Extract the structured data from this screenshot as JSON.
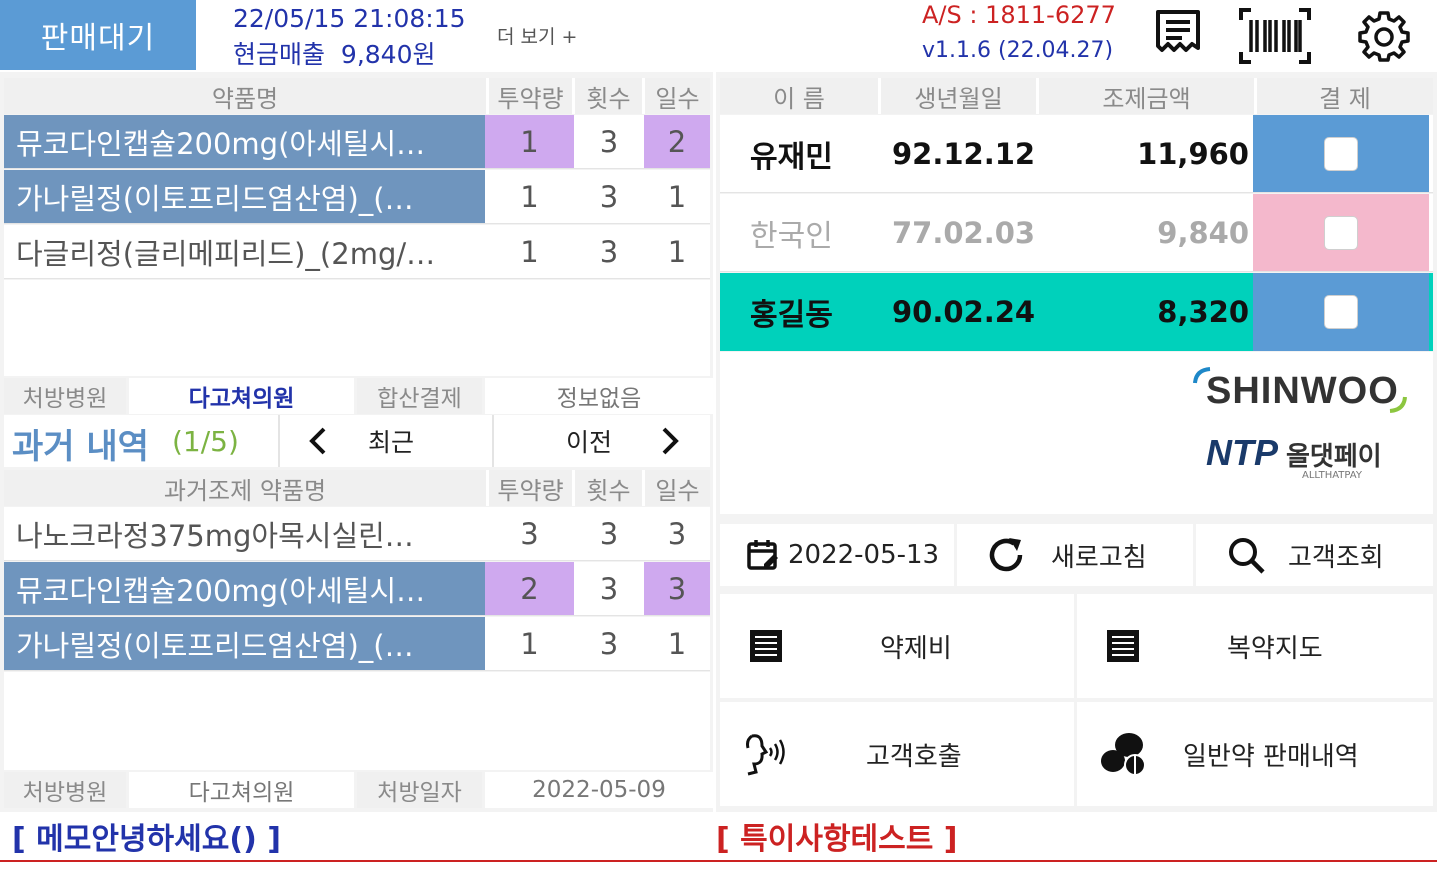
{
  "header": {
    "status": "판매대기",
    "datetime": "22/05/15 21:08:15",
    "cash_sales_label": "현금매출",
    "cash_sales_value": "9,840원",
    "more": "더 보기 +",
    "as_line": "A/S : 1811-6277",
    "version": "v1.1.6 (22.04.27)",
    "icons": [
      "receipt-icon",
      "barcode-icon",
      "gear-icon"
    ]
  },
  "current": {
    "headers": [
      "약품명",
      "투약량",
      "횟수",
      "일수"
    ],
    "rows": [
      {
        "name": "뮤코다인캡슐200mg(아세틸시…",
        "dose": "1",
        "count": "3",
        "days": "2"
      },
      {
        "name": "가나릴정(이토프리드염산염)_(…",
        "dose": "1",
        "count": "3",
        "days": "1"
      },
      {
        "name": "다글리정(글리메피리드)_(2mg/…",
        "dose": "1",
        "count": "3",
        "days": "1"
      }
    ],
    "info": {
      "hospital_label": "처방병원",
      "hospital": "다고쳐의원",
      "combined_label": "합산결제",
      "combined": "정보없음"
    }
  },
  "history": {
    "title": "과거 내역",
    "page": "(1/5)",
    "recent": "최근",
    "prev": "이전",
    "headers": [
      "과거조제 약품명",
      "투약량",
      "횟수",
      "일수"
    ],
    "rows": [
      {
        "name": "나노크라정375mg아목시실린…",
        "dose": "3",
        "count": "3",
        "days": "3"
      },
      {
        "name": "뮤코다인캡슐200mg(아세틸시…",
        "dose": "2",
        "count": "3",
        "days": "3"
      },
      {
        "name": "가나릴정(이토프리드염산염)_(…",
        "dose": "1",
        "count": "3",
        "days": "1"
      }
    ],
    "info": {
      "hospital_label": "처방병원",
      "hospital": "다고쳐의원",
      "date_label": "처방일자",
      "date": "2022-05-09"
    }
  },
  "patients": {
    "headers": [
      "이 름",
      "생년월일",
      "조제금액",
      "결 제"
    ],
    "rows": [
      {
        "name": "유재민",
        "birth": "92.12.12",
        "amount": "11,960"
      },
      {
        "name": "한국인",
        "birth": "77.02.03",
        "amount": "9,840"
      },
      {
        "name": "홍길동",
        "birth": "90.02.24",
        "amount": "8,320"
      }
    ]
  },
  "logos": {
    "shinwoo": "SHINWOO",
    "ntp": "NTP",
    "allthatpay": "올댓페이",
    "allthatpay_en": "ALLTHATPAY"
  },
  "actions": {
    "date": "2022-05-13",
    "refresh": "새로고침",
    "search": "고객조회",
    "drug_fee": "약제비",
    "guidance": "복약지도",
    "call": "고객호출",
    "otc_history": "일반약 판매내역"
  },
  "footer": {
    "memo": "[ 메모안녕하세요() ]",
    "note": "[ 특이사항테스트 ]"
  }
}
